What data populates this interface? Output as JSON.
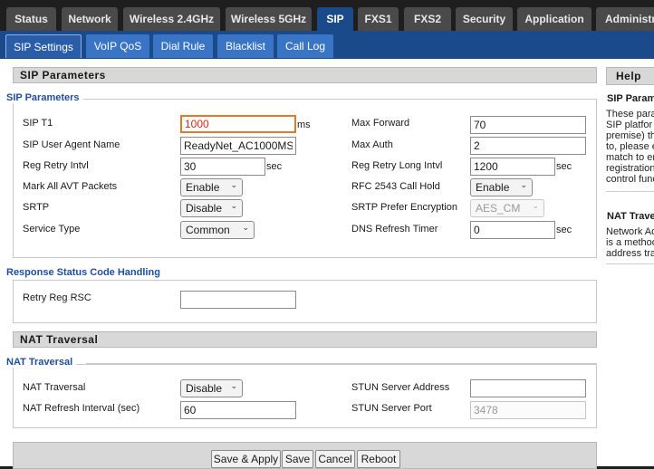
{
  "top_tabs": [
    "Status",
    "Network",
    "Wireless 2.4GHz",
    "Wireless 5GHz",
    "SIP",
    "FXS1",
    "FXS2",
    "Security",
    "Application",
    "Administra"
  ],
  "sub_tabs": [
    "SIP Settings",
    "VoIP QoS",
    "Dial Rule",
    "Blacklist",
    "Call Log"
  ],
  "sip_params": {
    "header": "SIP Parameters",
    "legend": "SIP Parameters",
    "sip_t1": {
      "label": "SIP T1",
      "value": "1000",
      "unit": "ms"
    },
    "user_agent": {
      "label": "SIP User Agent Name",
      "value": "ReadyNet_AC1000MS"
    },
    "reg_retry": {
      "label": "Reg Retry Intvl",
      "value": "30",
      "unit": "sec"
    },
    "mark_avt": {
      "label": "Mark All AVT Packets",
      "value": "Enable"
    },
    "srtp": {
      "label": "SRTP",
      "value": "Disable"
    },
    "service_type": {
      "label": "Service Type",
      "value": "Common"
    },
    "max_forward": {
      "label": "Max Forward",
      "value": "70"
    },
    "max_auth": {
      "label": "Max Auth",
      "value": "2"
    },
    "reg_retry_long": {
      "label": "Reg Retry Long Intvl",
      "value": "1200",
      "unit": "sec"
    },
    "rfc2543": {
      "label": "RFC 2543 Call Hold",
      "value": "Enable"
    },
    "srtp_encryption": {
      "label": "SRTP Prefer Encryption",
      "value": "AES_CM"
    },
    "dns_refresh": {
      "label": "DNS Refresh Timer",
      "value": "0",
      "unit": "sec"
    }
  },
  "response_status": {
    "legend": "Response Status Code Handling",
    "retry_reg_rsc": {
      "label": "Retry Reg RSC",
      "value": ""
    }
  },
  "nat": {
    "header": "NAT Traversal",
    "legend": "NAT Traversal",
    "nat_traversal": {
      "label": "NAT Traversal",
      "value": "Disable"
    },
    "nat_refresh": {
      "label": "NAT Refresh Interval (sec)",
      "value": "60"
    },
    "stun_address": {
      "label": "STUN Server Address",
      "value": ""
    },
    "stun_port": {
      "label": "STUN Server Port",
      "value": "3478"
    }
  },
  "buttons": {
    "save_apply": "Save & Apply",
    "save": "Save",
    "cancel": "Cancel",
    "reboot": "Reboot"
  },
  "help": {
    "header": "Help",
    "sip_title": "SIP Param",
    "sip_lines": [
      "These para",
      "SIP platfor",
      "premise) th",
      "to, please e",
      "match to er",
      "registration",
      "control func"
    ],
    "nat_title": "NAT Trave",
    "nat_lines": [
      "Network Ad",
      "is a method",
      "address tra"
    ]
  },
  "colors": {
    "accent": "#1a4a8a",
    "subtab": "#3a74c4",
    "legend": "#1f4e9c",
    "focus": "#e07a2a"
  }
}
